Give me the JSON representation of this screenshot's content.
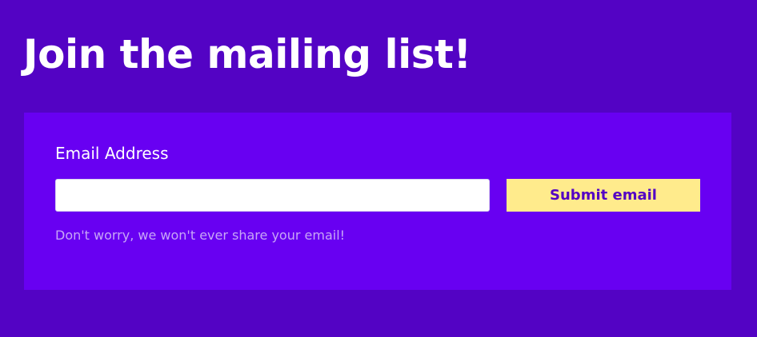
{
  "page": {
    "title": "Join the mailing list!"
  },
  "form": {
    "email_label": "Email Address",
    "email_value": "",
    "email_placeholder": "",
    "submit_label": "Submit email",
    "help_text": "Don't worry, we won't ever share your email!"
  },
  "colors": {
    "page_background": "#5303c4",
    "panel_background": "#6800f2",
    "button_background": "#ffeb8c",
    "button_text": "#5303c4",
    "help_text": "#c7a6f7",
    "title_text": "#ffffff"
  }
}
